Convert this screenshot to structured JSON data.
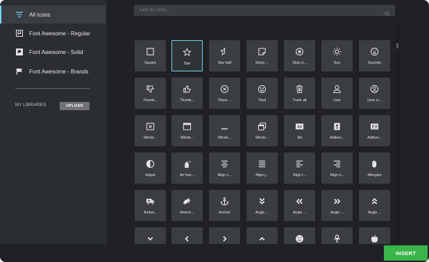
{
  "sidebar": {
    "items": [
      {
        "label": "All Icons",
        "icon": "list-icon",
        "active": true
      },
      {
        "label": "Font Awesome - Regular",
        "icon": "flag-regular-icon",
        "active": false
      },
      {
        "label": "Font Awesome - Solid",
        "icon": "flag-solid-icon",
        "active": false
      },
      {
        "label": "Font Awesome - Brands",
        "icon": "flag-brands-icon",
        "active": false
      }
    ],
    "my_libraries_label": "MY LIBRARIES",
    "upload_label": "UPLOAD"
  },
  "search": {
    "placeholder": "Filter by name...",
    "value": ""
  },
  "icons": [
    [
      {
        "label": "Square",
        "icon": "square-icon"
      },
      {
        "label": "Star",
        "icon": "star-icon",
        "selected": true
      },
      {
        "label": "Star half",
        "icon": "star-half-icon"
      },
      {
        "label": "Sticky ...",
        "icon": "sticky-note-icon"
      },
      {
        "label": "Stop ci...",
        "icon": "stop-circle-icon"
      },
      {
        "label": "Sun",
        "icon": "sun-icon"
      },
      {
        "label": "Surprise",
        "icon": "surprise-icon"
      }
    ],
    [
      {
        "label": "Thumb...",
        "icon": "thumbs-down-icon"
      },
      {
        "label": "Thumb...",
        "icon": "thumbs-up-icon"
      },
      {
        "label": "Times ...",
        "icon": "times-circle-icon"
      },
      {
        "label": "Tired",
        "icon": "tired-icon"
      },
      {
        "label": "Trash alt",
        "icon": "trash-icon"
      },
      {
        "label": "User",
        "icon": "user-icon"
      },
      {
        "label": "User ci...",
        "icon": "user-circle-icon"
      }
    ],
    [
      {
        "label": "Windo...",
        "icon": "window-close-icon"
      },
      {
        "label": "Windo...",
        "icon": "window-maximize-icon"
      },
      {
        "label": "Windo...",
        "icon": "window-minimize-icon"
      },
      {
        "label": "Windo...",
        "icon": "window-restore-icon"
      },
      {
        "label": "Ad",
        "icon": "ad-icon"
      },
      {
        "label": "Addres...",
        "icon": "address-book-icon"
      },
      {
        "label": "Addres...",
        "icon": "address-card-icon"
      }
    ],
    [
      {
        "label": "Adjust",
        "icon": "adjust-icon"
      },
      {
        "label": "Air free...",
        "icon": "air-freshener-icon"
      },
      {
        "label": "Align c...",
        "icon": "align-center-icon"
      },
      {
        "label": "Align j...",
        "icon": "align-justify-icon"
      },
      {
        "label": "Align l...",
        "icon": "align-left-icon"
      },
      {
        "label": "Align ri...",
        "icon": "align-right-icon"
      },
      {
        "label": "Allergies",
        "icon": "allergies-icon"
      }
    ],
    [
      {
        "label": "Ambul...",
        "icon": "ambulance-icon"
      },
      {
        "label": "Americ...",
        "icon": "american-sign-language-icon"
      },
      {
        "label": "Anchor",
        "icon": "anchor-icon"
      },
      {
        "label": "Angle ...",
        "icon": "angle-double-down-icon"
      },
      {
        "label": "Angle ...",
        "icon": "angle-double-left-icon"
      },
      {
        "label": "Angle ...",
        "icon": "angle-double-right-icon"
      },
      {
        "label": "Angle ...",
        "icon": "angle-double-up-icon"
      }
    ],
    [
      {
        "label": "",
        "icon": "angle-down-icon"
      },
      {
        "label": "",
        "icon": "angle-left-icon"
      },
      {
        "label": "",
        "icon": "angle-right-icon"
      },
      {
        "label": "",
        "icon": "angle-up-icon"
      },
      {
        "label": "",
        "icon": "angry-icon"
      },
      {
        "label": "",
        "icon": "ankh-icon"
      },
      {
        "label": "",
        "icon": "apple-alt-icon"
      }
    ]
  ],
  "footer": {
    "insert_label": "INSERT"
  },
  "colors": {
    "accent": "#71d7f7",
    "insert": "#39b54a",
    "tile": "#3a3d42",
    "background": "#1f2124"
  }
}
